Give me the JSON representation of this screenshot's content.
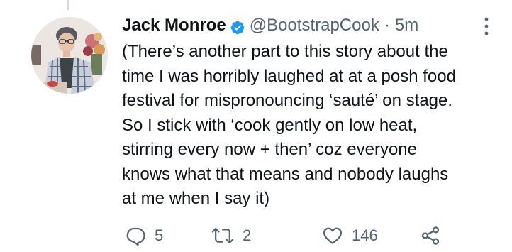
{
  "tweet": {
    "author_name": "Jack Monroe",
    "handle": "@BootstrapCook",
    "separator": "·",
    "time": "5m",
    "verified": true,
    "lines": [
      "(There’s another part to this story about the",
      "time I was horribly laughed at at a posh food",
      "festival for mispronouncing ‘sauté’ on stage.",
      "So I stick with ‘cook gently on low heat,",
      "stirring every now + then’ coz everyone",
      "knows what that means and nobody laughs",
      "at me when I say it)"
    ]
  },
  "actions": {
    "reply_count": "5",
    "retweet_count": "2",
    "like_count": "146"
  },
  "icons": {
    "verified": "verified-badge-icon",
    "more": "more-options-icon",
    "reply": "reply-icon",
    "retweet": "retweet-icon",
    "like": "heart-icon",
    "share": "share-icon"
  },
  "colors": {
    "text": "#0f1419",
    "secondary": "#536471",
    "verified": "#1d9bf0",
    "thread_line": "#cfd9de"
  }
}
